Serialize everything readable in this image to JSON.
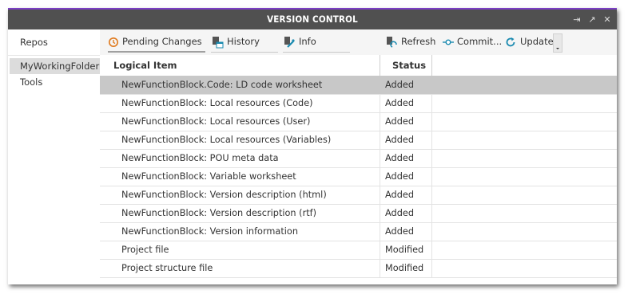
{
  "window": {
    "title": "VERSION CONTROL",
    "accent_color": "#7b3fc4",
    "titlebar_buttons": [
      {
        "icon": "pin-icon",
        "glyph": "⇥"
      },
      {
        "icon": "maximize-icon",
        "glyph": "↗"
      },
      {
        "icon": "close-icon",
        "glyph": "✕"
      }
    ]
  },
  "repos": {
    "header": "Repos",
    "items": [
      {
        "label": "MyWorkingFolder",
        "selected": true
      },
      {
        "label": "Tools",
        "selected": false
      }
    ]
  },
  "toolbar": {
    "tabs": [
      {
        "label": "Pending Changes",
        "icon": "pending-changes-icon",
        "active": true
      },
      {
        "label": "History",
        "icon": "history-icon",
        "active": false
      },
      {
        "label": "Info",
        "icon": "info-icon",
        "active": false
      }
    ],
    "refresh_label": "Refresh",
    "commit_label": "Commit...",
    "update_label": "Update"
  },
  "grid": {
    "columns": [
      "Logical Item",
      "Status"
    ],
    "rows": [
      {
        "item": "NewFunctionBlock.Code: LD code worksheet",
        "status": "Added",
        "selected": true
      },
      {
        "item": "NewFunctionBlock: Local resources (Code)",
        "status": "Added",
        "selected": false
      },
      {
        "item": "NewFunctionBlock: Local resources (User)",
        "status": "Added",
        "selected": false
      },
      {
        "item": "NewFunctionBlock: Local resources (Variables)",
        "status": "Added",
        "selected": false
      },
      {
        "item": "NewFunctionBlock: POU meta data",
        "status": "Added",
        "selected": false
      },
      {
        "item": "NewFunctionBlock: Variable worksheet",
        "status": "Added",
        "selected": false
      },
      {
        "item": "NewFunctionBlock: Version description (html)",
        "status": "Added",
        "selected": false
      },
      {
        "item": "NewFunctionBlock: Version description (rtf)",
        "status": "Added",
        "selected": false
      },
      {
        "item": "NewFunctionBlock: Version information",
        "status": "Added",
        "selected": false
      },
      {
        "item": "Project file",
        "status": "Modified",
        "selected": false
      },
      {
        "item": "Project structure file",
        "status": "Modified",
        "selected": false
      }
    ]
  }
}
